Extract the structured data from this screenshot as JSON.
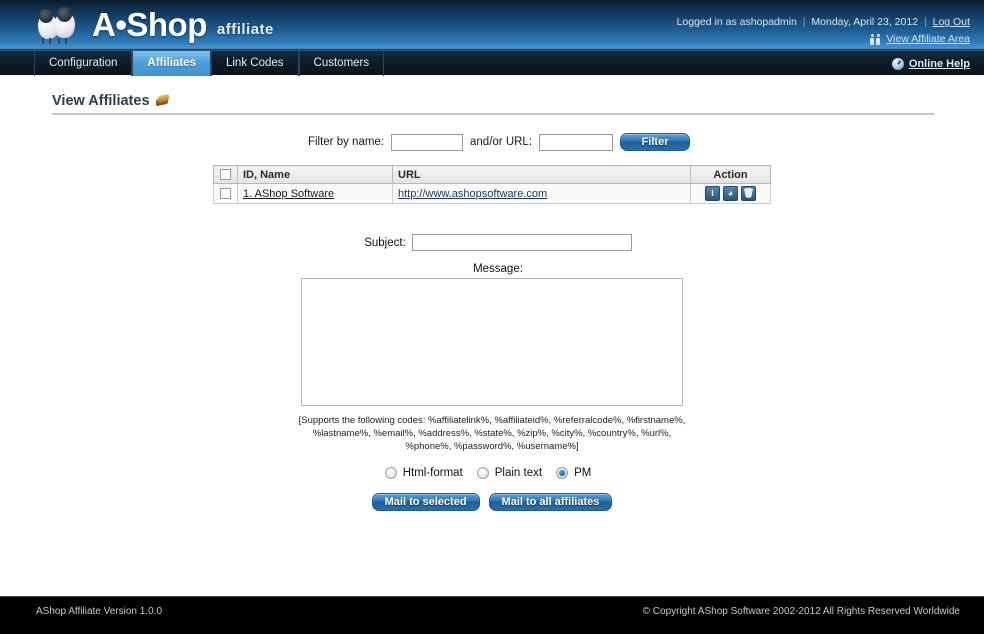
{
  "header": {
    "logo_name": "A•Shop",
    "logo_suffix": "affiliate",
    "logged_in_text": "Logged in as ashopadmin",
    "date": "Monday, April 23, 2012",
    "logout_label": "Log Out",
    "view_affiliate_area": "View Affiliate Area",
    "separator": "|"
  },
  "nav": {
    "tabs": [
      {
        "label": "Configuration",
        "active": false
      },
      {
        "label": "Affiliates",
        "active": true
      },
      {
        "label": "Link Codes",
        "active": false
      },
      {
        "label": "Customers",
        "active": false
      }
    ],
    "online_help": "Online Help"
  },
  "page": {
    "title": "View Affiliates"
  },
  "filter": {
    "name_label": "Filter by name:",
    "name_value": "",
    "url_label": "and/or URL:",
    "url_value": "",
    "button_label": "Filter"
  },
  "table": {
    "columns": [
      "ID, Name",
      "URL",
      "Action"
    ],
    "rows": [
      {
        "checked": false,
        "name": "1. AShop Software",
        "url": "http://www.ashopsoftware.com",
        "actions": [
          "info-icon",
          "stats-icon",
          "trash-icon"
        ]
      }
    ]
  },
  "mail_form": {
    "subject_label": "Subject:",
    "subject_value": "",
    "message_label": "Message:",
    "message_value": "",
    "codes_hint": "[Supports the following codes: %affiliatelink%, %affiliateid%, %referralcode%, %firstname%, %lastname%, %email%, %address%, %state%, %zip%, %city%, %country%, %url%, %phone%, %password%, %username%]",
    "format_options": [
      {
        "label": "Html-format",
        "selected": false
      },
      {
        "label": "Plain text",
        "selected": false
      },
      {
        "label": "PM",
        "selected": true
      }
    ],
    "mail_selected_label": "Mail to selected",
    "mail_all_label": "Mail to all affiliates"
  },
  "footer": {
    "version": "AShop Affiliate Version 1.0.0",
    "copyright": "© Copyright AShop Software 2002-2012 All Rights Reserved Worldwide"
  },
  "colors": {
    "header_blue": "#2f7cbb",
    "tab_active": "#4f9fd8",
    "button_blue": "#2f76b3",
    "footer_bg": "#000000"
  }
}
